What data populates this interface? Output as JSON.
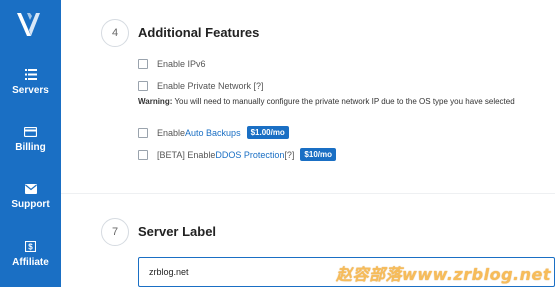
{
  "sidebar": {
    "items": [
      {
        "label": "Servers",
        "icon": "server-list-icon"
      },
      {
        "label": "Billing",
        "icon": "credit-card-icon"
      },
      {
        "label": "Support",
        "icon": "envelope-icon"
      },
      {
        "label": "Affiliate",
        "icon": "dollar-icon"
      }
    ]
  },
  "features": {
    "step": "4",
    "title": "Additional Features",
    "ipv6_label": "Enable IPv6",
    "private_network_label": "Enable Private Network [?]",
    "warning_prefix": "Warning:",
    "warning_text": " You will need to manually configure the private network IP due to the OS type you have selected",
    "auto_backups_prefix": "Enable ",
    "auto_backups_link": "Auto Backups",
    "auto_backups_price": "$1.00/mo",
    "ddos_prefix": "[BETA] Enable ",
    "ddos_link": "DDOS Protection",
    "ddos_suffix": " [?]",
    "ddos_price": "$10/mo"
  },
  "server_label": {
    "step": "7",
    "title": "Server Label",
    "value": "zrblog.net"
  },
  "watermark": "赵容部落www.zrblog.net",
  "colors": {
    "accent": "#1a6fc4",
    "sidebar": "#1a6fc4",
    "watermark": "#f5a623"
  }
}
